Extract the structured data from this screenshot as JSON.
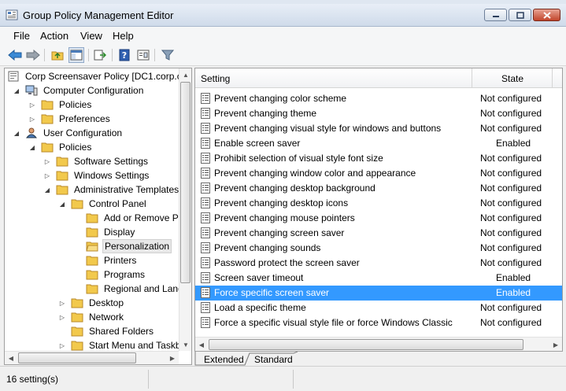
{
  "window": {
    "title": "Group Policy Management Editor"
  },
  "menu": [
    "File",
    "Action",
    "View",
    "Help"
  ],
  "tree": {
    "root": "Corp Screensaver Policy [DC1.corp.c",
    "computer_configuration": "Computer Configuration",
    "cc_policies": "Policies",
    "cc_preferences": "Preferences",
    "user_configuration": "User Configuration",
    "uc_policies": "Policies",
    "software_settings": "Software Settings",
    "windows_settings": "Windows Settings",
    "administrative_templates": "Administrative Templates",
    "control_panel": "Control Panel",
    "add_remove": "Add or Remove Pr",
    "display": "Display",
    "personalization": "Personalization",
    "printers": "Printers",
    "programs": "Programs",
    "regional": "Regional and Lang",
    "desktop": "Desktop",
    "network": "Network",
    "shared_folders": "Shared Folders",
    "start_menu": "Start Menu and Taskb"
  },
  "columns": {
    "setting": "Setting",
    "state": "State"
  },
  "settings": [
    {
      "name": "Prevent changing color scheme",
      "state": "Not configured"
    },
    {
      "name": "Prevent changing theme",
      "state": "Not configured"
    },
    {
      "name": "Prevent changing visual style for windows and buttons",
      "state": "Not configured"
    },
    {
      "name": "Enable screen saver",
      "state": "Enabled"
    },
    {
      "name": "Prohibit selection of visual style font size",
      "state": "Not configured"
    },
    {
      "name": "Prevent changing window color and appearance",
      "state": "Not configured"
    },
    {
      "name": "Prevent changing desktop background",
      "state": "Not configured"
    },
    {
      "name": "Prevent changing desktop icons",
      "state": "Not configured"
    },
    {
      "name": "Prevent changing mouse pointers",
      "state": "Not configured"
    },
    {
      "name": "Prevent changing screen saver",
      "state": "Not configured"
    },
    {
      "name": "Prevent changing sounds",
      "state": "Not configured"
    },
    {
      "name": "Password protect the screen saver",
      "state": "Not configured"
    },
    {
      "name": "Screen saver timeout",
      "state": "Enabled"
    },
    {
      "name": "Force specific screen saver",
      "state": "Enabled"
    },
    {
      "name": "Load a specific theme",
      "state": "Not configured"
    },
    {
      "name": "Force a specific visual style file or force Windows Classic",
      "state": "Not configured"
    }
  ],
  "selected_setting_index": 13,
  "tabs": {
    "extended": "Extended",
    "standard": "Standard"
  },
  "status": {
    "count": "16 setting(s)"
  },
  "colors": {
    "selection": "#3399ff",
    "folder": "#f2c94c"
  }
}
